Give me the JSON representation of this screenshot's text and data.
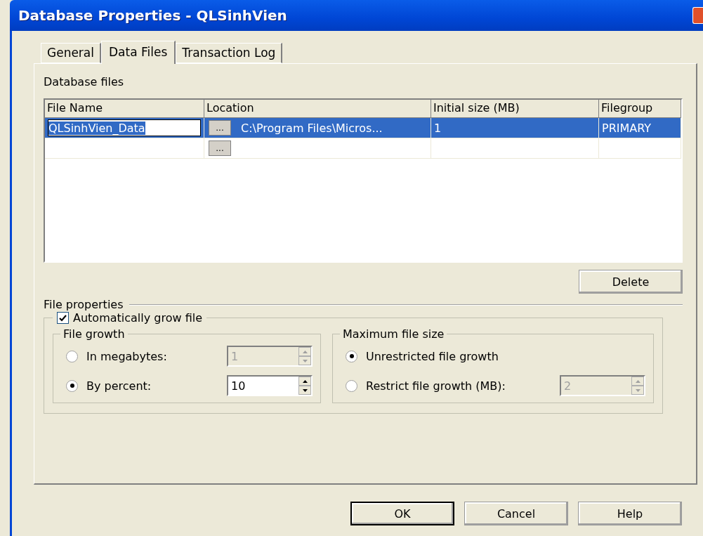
{
  "window": {
    "title": "Database Properties - QLSinhVien"
  },
  "tabs": [
    {
      "label": "General",
      "selected": false
    },
    {
      "label": "Data Files",
      "selected": true
    },
    {
      "label": "Transaction Log",
      "selected": false
    }
  ],
  "database_files": {
    "label": "Database files",
    "columns": [
      "File Name",
      "Location",
      "Initial size (MB)",
      "Filegroup"
    ],
    "rows": [
      {
        "file_name": "QLSinhVien_Data",
        "browse": "...",
        "location": "C:\\Program Files\\Micros...",
        "initial_size": "1",
        "filegroup": "PRIMARY",
        "selected": true
      },
      {
        "browse": "...",
        "selected": false
      }
    ]
  },
  "delete_button": "Delete",
  "file_properties": {
    "label": "File properties",
    "auto_grow": {
      "label": "Automatically grow file",
      "checked": true
    },
    "file_growth": {
      "label": "File growth",
      "options": [
        {
          "label": "In megabytes:",
          "selected": false,
          "value": "1",
          "disabled": true
        },
        {
          "label": "By percent:",
          "selected": true,
          "value": "10",
          "disabled": false
        }
      ]
    },
    "max_size": {
      "label": "Maximum file size",
      "options": [
        {
          "label": "Unrestricted file growth",
          "selected": true
        },
        {
          "label": "Restrict file growth (MB):",
          "selected": false,
          "value": "2",
          "disabled": true
        }
      ]
    }
  },
  "buttons": [
    {
      "label": "OK",
      "default": true
    },
    {
      "label": "Cancel",
      "default": false
    },
    {
      "label": "Help",
      "default": false
    }
  ]
}
